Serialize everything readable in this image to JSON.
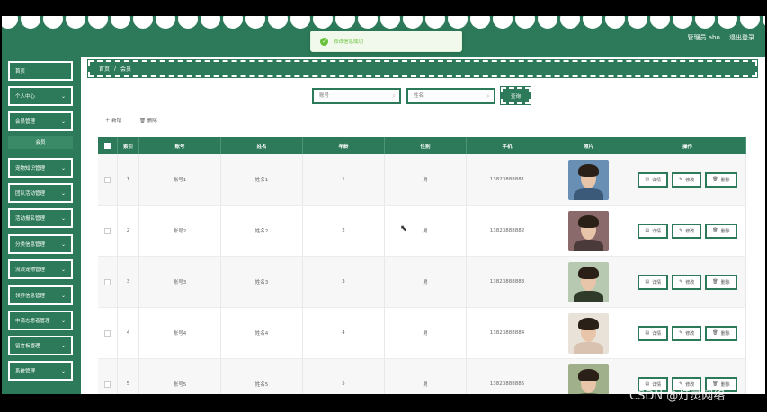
{
  "header": {
    "user_label": "管理员 abo",
    "logout_label": "退出登录"
  },
  "toast": {
    "message": "修改信息成功"
  },
  "sidebar": {
    "items": [
      {
        "label": "首页",
        "expandable": false
      },
      {
        "label": "个人中心",
        "expandable": true
      },
      {
        "label": "会员管理",
        "expandable": true
      },
      {
        "label": "宠物知识管理",
        "expandable": true
      },
      {
        "label": "团队活动管理",
        "expandable": true
      },
      {
        "label": "活动报名管理",
        "expandable": true
      },
      {
        "label": "分类信息管理",
        "expandable": true
      },
      {
        "label": "流浪宠物管理",
        "expandable": true
      },
      {
        "label": "领养信息管理",
        "expandable": true
      },
      {
        "label": "申请志愿者管理",
        "expandable": true
      },
      {
        "label": "留言板管理",
        "expandable": true
      },
      {
        "label": "系统管理",
        "expandable": true
      }
    ],
    "submenu_label": "会员"
  },
  "breadcrumb": {
    "home": "首页",
    "separator": "/",
    "current": "会员"
  },
  "search": {
    "account_placeholder": "账号",
    "name_placeholder": "姓名",
    "button_label": "查询"
  },
  "toolbar": {
    "add_label": "新增",
    "delete_label": "删除"
  },
  "table": {
    "headers": [
      "索引",
      "账号",
      "姓名",
      "年龄",
      "性别",
      "手机",
      "照片",
      "操作"
    ],
    "rows": [
      {
        "index": "1",
        "account": "账号1",
        "name": "姓名1",
        "age": "1",
        "gender": "男",
        "phone": "13823888881"
      },
      {
        "index": "2",
        "account": "账号2",
        "name": "姓名2",
        "age": "2",
        "gender": "男",
        "phone": "13823888882"
      },
      {
        "index": "3",
        "account": "账号3",
        "name": "姓名3",
        "age": "3",
        "gender": "男",
        "phone": "13823888883"
      },
      {
        "index": "4",
        "account": "账号4",
        "name": "姓名4",
        "age": "4",
        "gender": "男",
        "phone": "13823888884"
      },
      {
        "index": "5",
        "account": "账号5",
        "name": "姓名5",
        "age": "5",
        "gender": "男",
        "phone": "13823888885"
      }
    ],
    "actions": {
      "detail": "详情",
      "edit": "修改",
      "delete": "删除"
    }
  },
  "watermark": "CSDN @灯灵网络",
  "colors": {
    "primary": "#2c7a59",
    "toast_success": "#67c23a"
  }
}
